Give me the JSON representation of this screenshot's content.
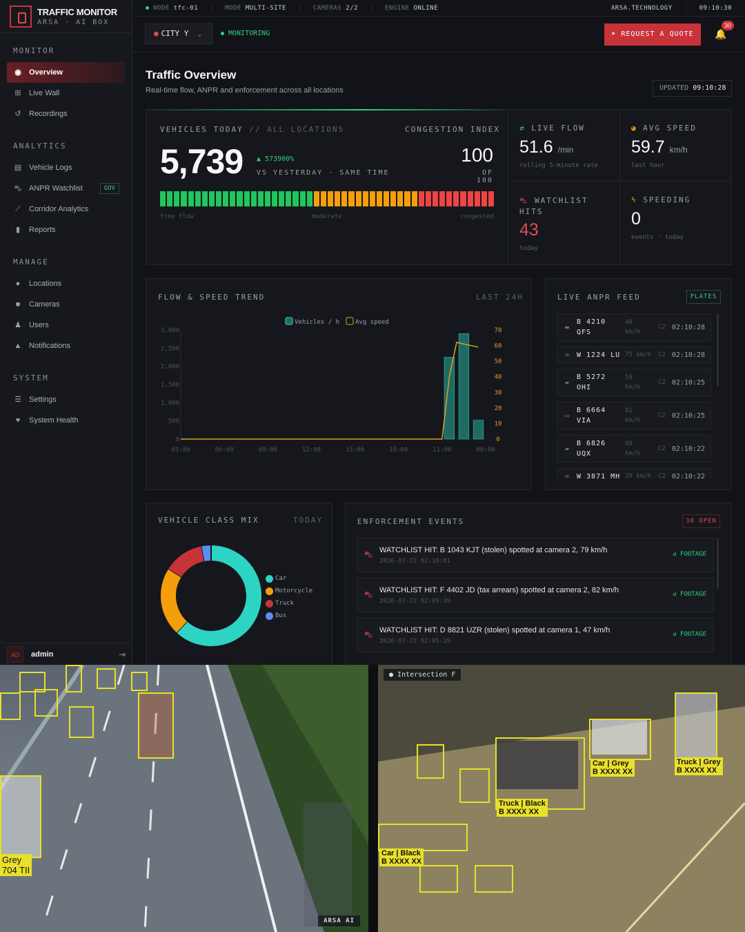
{
  "brand": {
    "name": "TRAFFIC MONITOR",
    "sub": "ARSA · AI BOX"
  },
  "topbar": {
    "node_label": "NODE",
    "node": "tfc-01",
    "mode_label": "MODE",
    "mode": "MULTI-SITE",
    "cameras_label": "CAMERAS",
    "cameras": "2/2",
    "engine_label": "ENGINE",
    "engine": "ONLINE",
    "domain": "ARSA.TECHNOLOGY",
    "time": "09:10:30"
  },
  "header": {
    "city": "CITY Y",
    "status": "MONITORING",
    "quote": "REQUEST A QUOTE",
    "notif_count": "30"
  },
  "sidebar": {
    "monitor": "MONITOR",
    "analytics": "ANALYTICS",
    "manage": "MANAGE",
    "system": "SYSTEM",
    "items": [
      {
        "label": "Overview",
        "icon": "gauge-icon"
      },
      {
        "label": "Live Wall",
        "icon": "grid-icon"
      },
      {
        "label": "Recordings",
        "icon": "history-icon"
      },
      {
        "label": "Vehicle Logs",
        "icon": "table-icon"
      },
      {
        "label": "ANPR Watchlist",
        "icon": "car-alert-icon",
        "badge": "GOV"
      },
      {
        "label": "Corridor Analytics",
        "icon": "line-chart-icon"
      },
      {
        "label": "Reports",
        "icon": "file-icon"
      },
      {
        "label": "Locations",
        "icon": "pin-icon"
      },
      {
        "label": "Cameras",
        "icon": "camera-icon"
      },
      {
        "label": "Users",
        "icon": "users-icon"
      },
      {
        "label": "Notifications",
        "icon": "bell-icon"
      },
      {
        "label": "Settings",
        "icon": "sliders-icon"
      },
      {
        "label": "System Health",
        "icon": "heart-pulse-icon"
      }
    ],
    "user": {
      "initials": "AD",
      "name": "admin"
    }
  },
  "page": {
    "title": "Traffic Overview",
    "subtitle": "Real-time flow, ANPR and enforcement across all locations",
    "updated_label": "UPDATED",
    "updated": "09:10:28"
  },
  "kpi": {
    "vehicles_label": "VEHICLES TODAY",
    "vehicles_scope": "// ALL LOCATIONS",
    "vehicles": "5,739",
    "delta": "▲ 573900%",
    "vs": "VS YESTERDAY · SAME TIME",
    "congestion_label": "CONGESTION INDEX",
    "congestion": "100",
    "congestion_of": "OF 100",
    "congestion_level": 1.0,
    "scale": [
      "free flow",
      "moderate",
      "congested"
    ],
    "live_flow_label": "LIVE FLOW",
    "live_flow": "51.6",
    "live_flow_unit": "/min",
    "live_flow_sub": "rolling 5-minute rate",
    "avg_speed_label": "AVG SPEED",
    "avg_speed": "59.7",
    "avg_speed_unit": "km/h",
    "avg_speed_sub": "last hour",
    "watchlist_label": "WATCHLIST HITS",
    "watchlist": "43",
    "watchlist_sub": "today",
    "speeding_label": "SPEEDING",
    "speeding": "0",
    "speeding_sub": "events · today"
  },
  "trend": {
    "title": "FLOW & SPEED TREND",
    "range": "LAST 24H"
  },
  "chart_data": {
    "type": "bar",
    "title": "",
    "categories": [
      "03:00",
      "06:00",
      "09:00",
      "12:00",
      "15:00",
      "18:00",
      "21:00",
      "00:00"
    ],
    "x_ticks": [
      "03:00",
      "06:00",
      "09:00",
      "12:00",
      "15:00",
      "18:00",
      "21:00",
      "00:00"
    ],
    "y_left_ticks": [
      "0",
      "500",
      "1,000",
      "1,500",
      "2,000",
      "2,500",
      "3,000"
    ],
    "y_right_ticks": [
      "0",
      "10",
      "20",
      "30",
      "40",
      "50",
      "60",
      "70"
    ],
    "ylim_left": [
      0,
      3000
    ],
    "ylim_right": [
      0,
      70
    ],
    "legend": [
      "Vehicles / h",
      "Avg speed"
    ],
    "legend_position": "top-center",
    "series": [
      {
        "name": "Vehicles / h",
        "kind": "bar",
        "color": "#1f6b63",
        "x": [
          21.5,
          22.5,
          23.5
        ],
        "values": [
          2250,
          2900,
          520
        ]
      },
      {
        "name": "Avg speed",
        "kind": "line",
        "color": "#e0a020",
        "x": [
          3,
          20.5,
          21.0,
          21.5,
          22.0,
          22.5,
          23.0,
          23.5
        ],
        "values": [
          0,
          0,
          0,
          40,
          62,
          61,
          60,
          59
        ]
      }
    ]
  },
  "anpr": {
    "title": "LIVE ANPR FEED",
    "plates": "PLATES",
    "rows": [
      {
        "plate": "B 4210 QFS",
        "speed": "40 km/h",
        "cam": "C2",
        "time": "02:10:28",
        "icon": "truck-icon"
      },
      {
        "plate": "W 1224 LU",
        "speed": "75 km/h",
        "cam": "C2",
        "time": "02:10:28",
        "icon": "motorcycle-icon",
        "one": true
      },
      {
        "plate": "B 5272 OHI",
        "speed": "59 km/h",
        "cam": "C2",
        "time": "02:10:25",
        "icon": "car-icon"
      },
      {
        "plate": "B 6664 VIA",
        "speed": "81 km/h",
        "cam": "C2",
        "time": "02:10:25",
        "icon": "bus-icon"
      },
      {
        "plate": "B 6826 UQX",
        "speed": "40 km/h",
        "cam": "C2",
        "time": "02:10:22",
        "icon": "car-icon"
      },
      {
        "plate": "W 3871 MH",
        "speed": "39 km/h",
        "cam": "C2",
        "time": "02:10:22",
        "icon": "motorcycle-icon",
        "one": true
      }
    ]
  },
  "mix": {
    "title": "VEHICLE CLASS MIX",
    "range": "TODAY",
    "slices": [
      {
        "name": "Car",
        "value": 62,
        "color": "#2dd4c4"
      },
      {
        "name": "Motorcycle",
        "value": 22,
        "color": "#f59e0b"
      },
      {
        "name": "Truck",
        "value": 13,
        "color": "#c8333a"
      },
      {
        "name": "Bus",
        "value": 3,
        "color": "#5b8def"
      }
    ]
  },
  "enforcement": {
    "title": "ENFORCEMENT EVENTS",
    "open": "30 OPEN",
    "footage": "FOOTAGE",
    "rows": [
      {
        "text": "WATCHLIST HIT: B 1043 KJT (stolen) spotted at camera 2, 79 km/h",
        "date": "2026-07-22 02:10:01"
      },
      {
        "text": "WATCHLIST HIT: F 4402 JD (tax arrears) spotted at camera 2, 82 km/h",
        "date": "2026-07-22 02:09:39"
      },
      {
        "text": "WATCHLIST HIT: D 8821 UZR (stolen) spotted at camera 1, 47 km/h",
        "date": "2026-07-22 02:05:29"
      }
    ]
  },
  "cams": {
    "cam2_label": "Intersection F",
    "watermark": "ARSA AI",
    "tags": [
      "Grey",
      "704 TII",
      "Car | Grey",
      "B XXXX XX",
      "Truck | Black",
      "Car | Black",
      "Truck | Grey"
    ]
  }
}
